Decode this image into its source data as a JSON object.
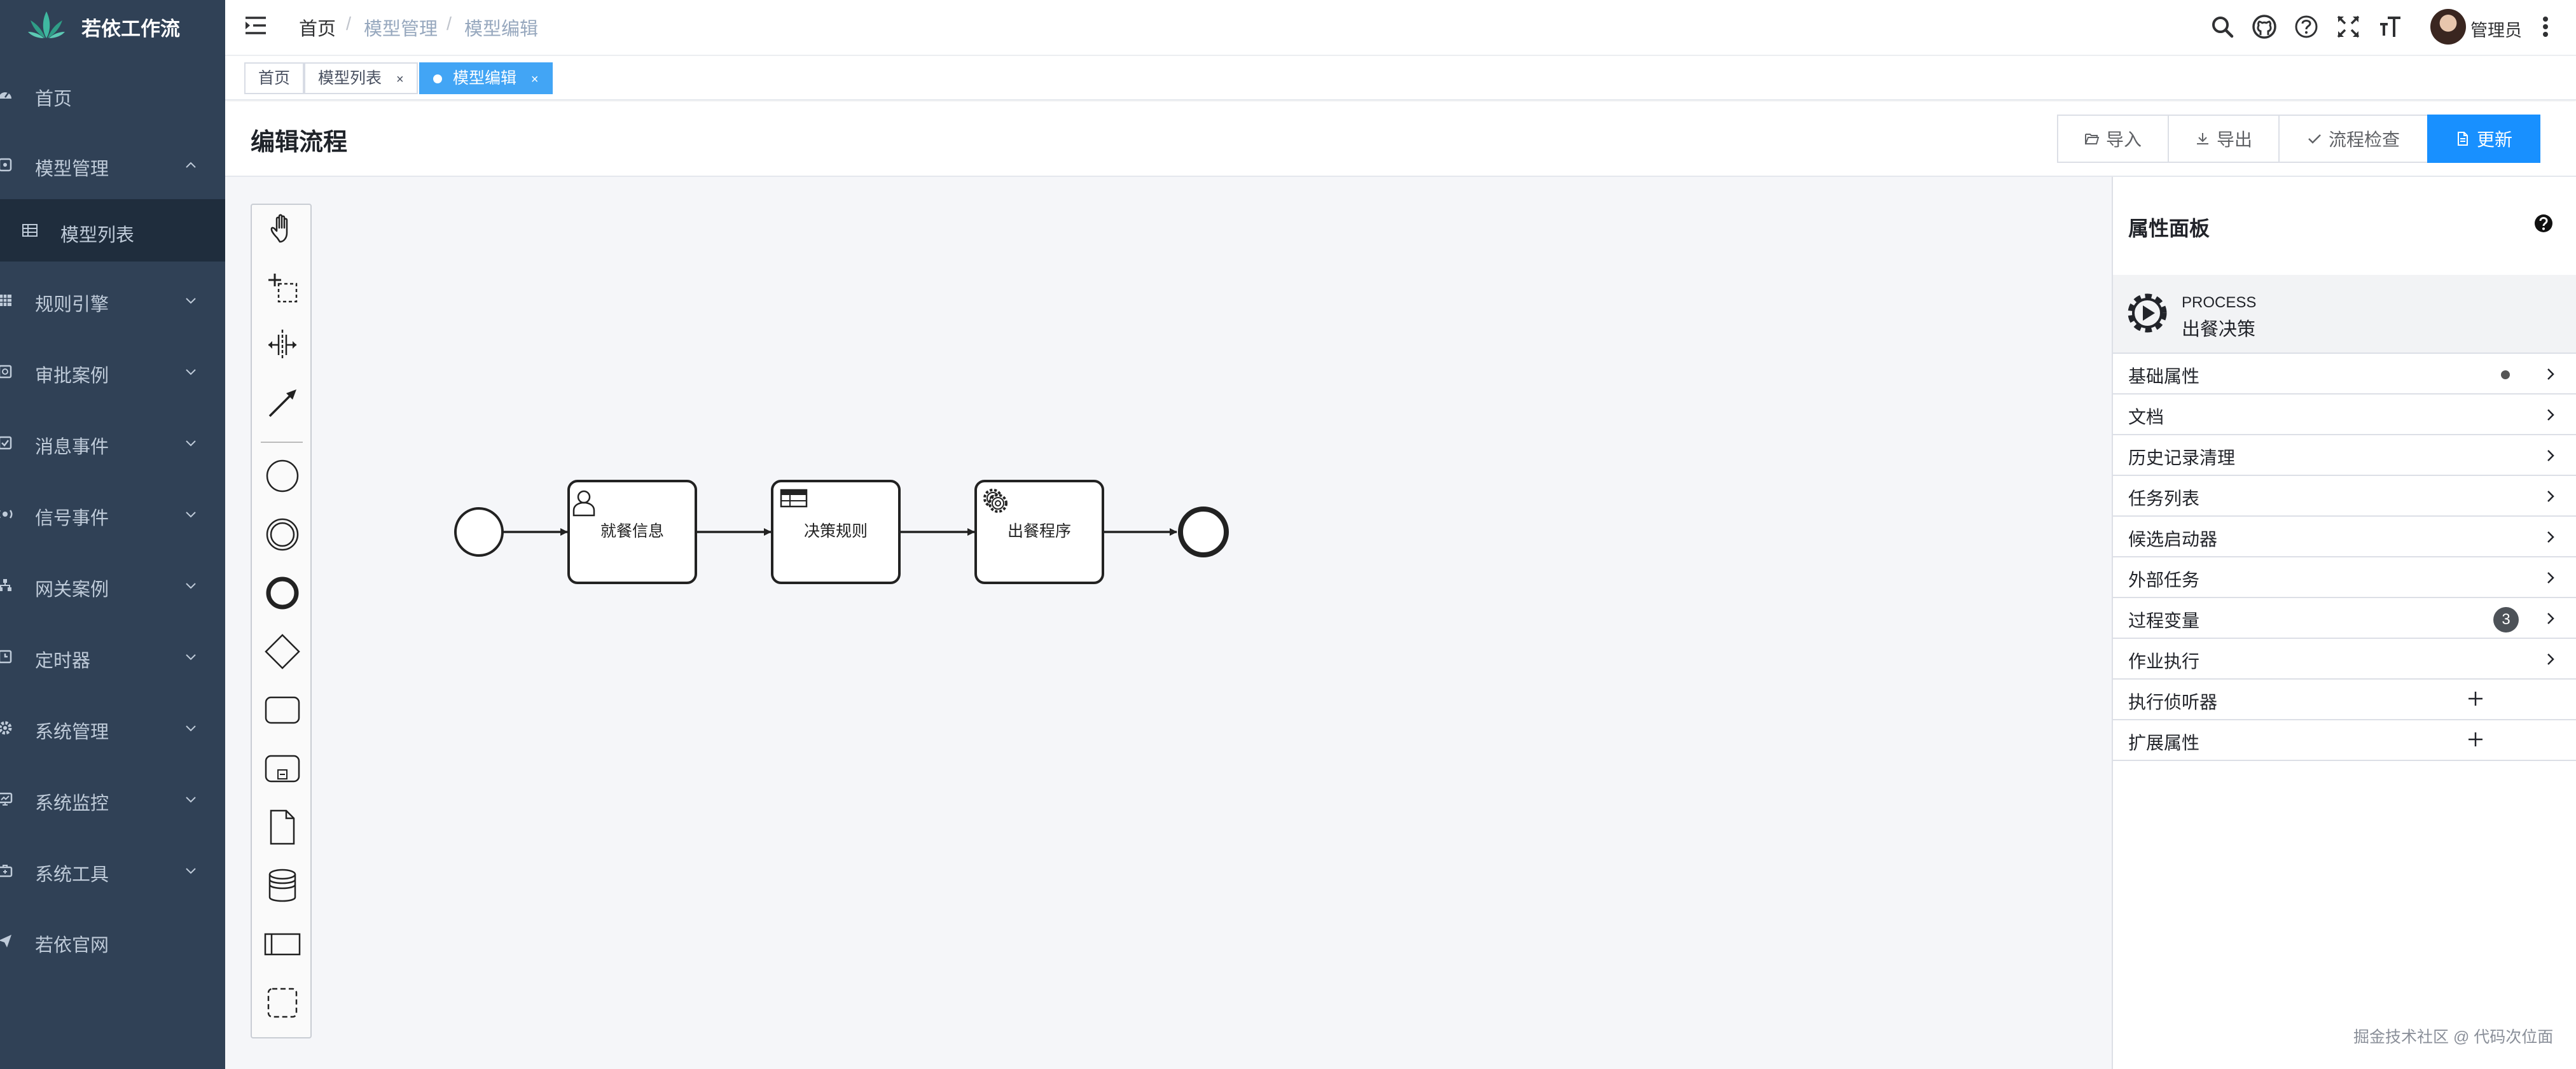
{
  "app": {
    "title": "若依工作流"
  },
  "sidebar": {
    "items": [
      {
        "label": "首页",
        "icon": "dashboard-icon"
      },
      {
        "label": "模型管理",
        "icon": "model-icon",
        "expanded": true
      },
      {
        "label": "规则引擎",
        "icon": "table-icon"
      },
      {
        "label": "审批案例",
        "icon": "approval-icon"
      },
      {
        "label": "消息事件",
        "icon": "message-icon"
      },
      {
        "label": "信号事件",
        "icon": "signal-icon"
      },
      {
        "label": "网关案例",
        "icon": "gateway-icon"
      },
      {
        "label": "定时器",
        "icon": "timer-icon"
      },
      {
        "label": "系统管理",
        "icon": "gear-icon"
      },
      {
        "label": "系统监控",
        "icon": "monitor-icon"
      },
      {
        "label": "系统工具",
        "icon": "tool-icon"
      },
      {
        "label": "若依官网",
        "icon": "send-icon"
      }
    ],
    "submenu": {
      "label": "模型列表",
      "icon": "grid-icon"
    }
  },
  "navbar": {
    "breadcrumb": [
      "首页",
      "模型管理",
      "模型编辑"
    ],
    "separator": "/",
    "user": "管理员",
    "icons": [
      "search-icon",
      "github-icon",
      "help-icon",
      "fullscreen-icon",
      "font-size-icon"
    ]
  },
  "tags": [
    {
      "label": "首页",
      "active": false,
      "closable": false
    },
    {
      "label": "模型列表",
      "active": false,
      "closable": true
    },
    {
      "label": "模型编辑",
      "active": true,
      "closable": true
    }
  ],
  "tag_close": "×",
  "page": {
    "title": "编辑流程"
  },
  "toolbar": {
    "import_label": "导入",
    "export_label": "导出",
    "check_label": "流程检查",
    "update_label": "更新"
  },
  "diagram": {
    "tasks": [
      {
        "label": "就餐信息",
        "type": "user-task"
      },
      {
        "label": "决策规则",
        "type": "business-rule-task"
      },
      {
        "label": "出餐程序",
        "type": "service-task"
      }
    ]
  },
  "properties": {
    "title": "属性面板",
    "process": {
      "type": "PROCESS",
      "name": "出餐决策"
    },
    "groups": [
      {
        "label": "基础属性",
        "marker": "dot"
      },
      {
        "label": "文档"
      },
      {
        "label": "历史记录清理"
      },
      {
        "label": "任务列表"
      },
      {
        "label": "候选启动器"
      },
      {
        "label": "外部任务"
      },
      {
        "label": "过程变量",
        "badge": "3"
      },
      {
        "label": "作业执行"
      },
      {
        "label": "执行侦听器",
        "action": "add"
      },
      {
        "label": "扩展属性",
        "action": "add"
      }
    ]
  },
  "watermark": "掘金技术社区 @ 代码次位面",
  "colors": {
    "sidebar": "#304156",
    "primary": "#1890ff",
    "tag_active": "#42a5f5"
  }
}
